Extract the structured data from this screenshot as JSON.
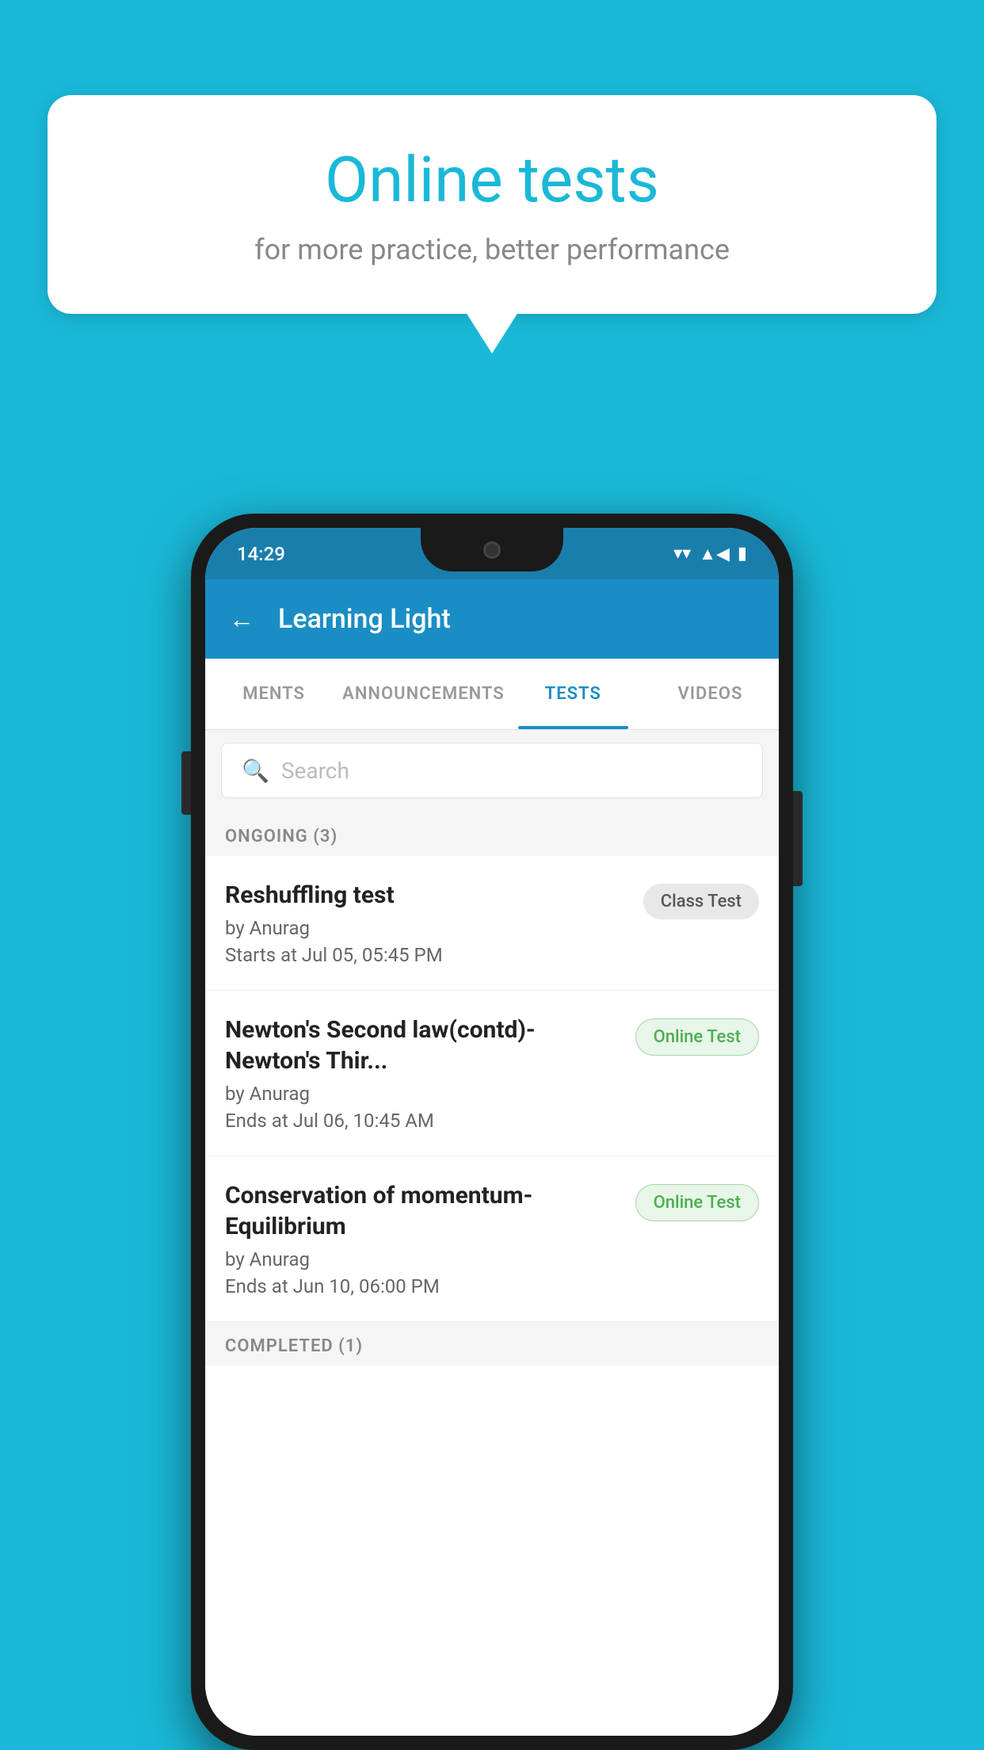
{
  "background": {
    "color": "#1ab8d8"
  },
  "speech_bubble": {
    "title": "Online tests",
    "subtitle": "for more practice, better performance"
  },
  "phone": {
    "status_bar": {
      "time": "14:29",
      "wifi": "▼",
      "signal": "▲",
      "battery": "▮"
    },
    "app_bar": {
      "title": "Learning Light",
      "back_label": "←"
    },
    "tabs": [
      {
        "label": "MENTS",
        "active": false
      },
      {
        "label": "ANNOUNCEMENTS",
        "active": false
      },
      {
        "label": "TESTS",
        "active": true
      },
      {
        "label": "VIDEOS",
        "active": false
      }
    ],
    "search": {
      "placeholder": "Search"
    },
    "ongoing_section": {
      "title": "ONGOING (3)"
    },
    "tests": [
      {
        "name": "Reshuffling test",
        "by": "by Anurag",
        "date": "Starts at  Jul 05, 05:45 PM",
        "badge": "Class Test",
        "badge_type": "class"
      },
      {
        "name": "Newton's Second law(contd)-Newton's Thir...",
        "by": "by Anurag",
        "date": "Ends at  Jul 06, 10:45 AM",
        "badge": "Online Test",
        "badge_type": "online"
      },
      {
        "name": "Conservation of momentum-Equilibrium",
        "by": "by Anurag",
        "date": "Ends at  Jun 10, 06:00 PM",
        "badge": "Online Test",
        "badge_type": "online"
      }
    ],
    "completed_section": {
      "title": "COMPLETED (1)"
    }
  }
}
